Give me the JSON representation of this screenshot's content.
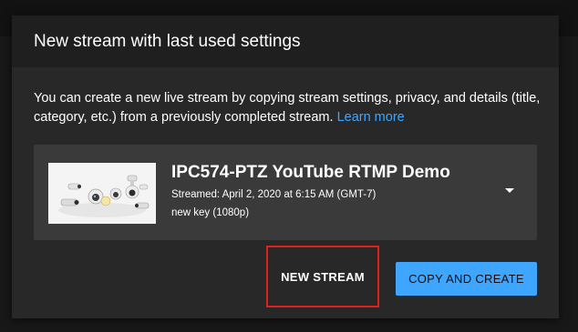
{
  "dialog": {
    "title": "New stream with last used settings",
    "description": "You can create a new live stream by copying stream settings, privacy, and details (title, category, etc.) from a previously completed stream.",
    "learn_more": "Learn more"
  },
  "stream": {
    "title": "IPC574-PTZ YouTube RTMP Demo",
    "streamed": "Streamed: April 2, 2020 at 6:15 AM (GMT-7)",
    "key": "new key (1080p)",
    "thumbnail_icon": "camera-product-thumbnail"
  },
  "actions": {
    "new_stream": "NEW STREAM",
    "copy_and_create": "COPY AND CREATE"
  },
  "colors": {
    "accent": "#3ea6ff",
    "highlight_border": "#e02020",
    "dialog_bg": "#282828",
    "header_bg": "#1f1f1f",
    "card_bg": "#3a3a3a"
  }
}
